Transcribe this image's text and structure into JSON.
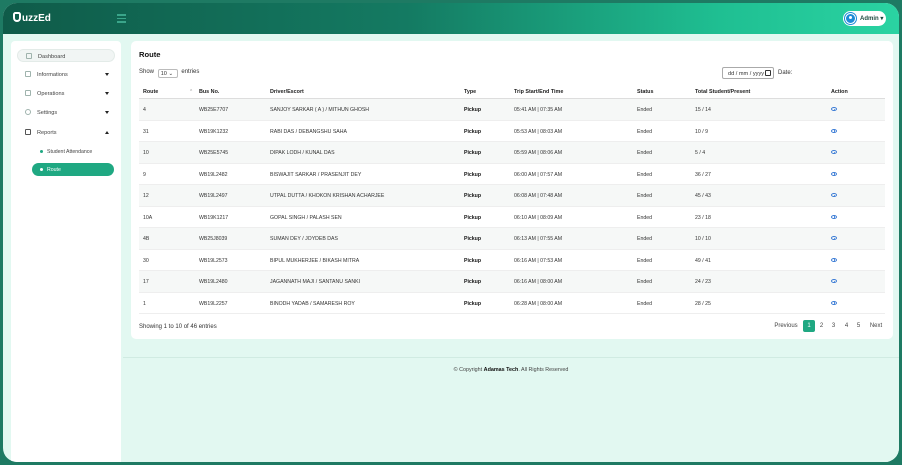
{
  "header": {
    "logo": "uzzEd",
    "admin_label": "Admin"
  },
  "sidebar": {
    "items": [
      {
        "label": "Dashboard",
        "icon": "dashboard-icon"
      },
      {
        "label": "Informations",
        "icon": "info-icon"
      },
      {
        "label": "Operations",
        "icon": "operations-icon"
      },
      {
        "label": "Settings",
        "icon": "gear-icon"
      },
      {
        "label": "Reports",
        "icon": "report-icon"
      }
    ],
    "sub_items": [
      {
        "label": "Student Attendance"
      },
      {
        "label": "Route"
      }
    ]
  },
  "main": {
    "title": "Route",
    "show_label": "Show",
    "show_value": "10",
    "entries_label": "entries",
    "date_placeholder": "dd / mm / yyyy",
    "date_label": "Date:",
    "columns": [
      "Route",
      "Bus No.",
      "Driver/Escort",
      "Type",
      "Trip Start/End Time",
      "Status",
      "Total Student/Present",
      "Action"
    ],
    "rows": [
      [
        "4",
        "WB25E7707",
        "SANJOY SARKAR ( A ) / MITHUN GHOSH",
        "Pickup",
        "05:41 AM | 07:35 AM",
        "Ended",
        "15 / 14"
      ],
      [
        "31",
        "WB19K1232",
        "RABI DAS / DEBANGSHU SAHA",
        "Pickup",
        "05:53 AM | 08:03 AM",
        "Ended",
        "10 / 9"
      ],
      [
        "10",
        "WB25E5745",
        "DIPAK LODH / KUNAL DAS",
        "Pickup",
        "05:59 AM | 08:06 AM",
        "Ended",
        "5 / 4"
      ],
      [
        "9",
        "WB19L2482",
        "BISWAJIT SARKAR / PRASENJIT DEY",
        "Pickup",
        "06:00 AM | 07:57 AM",
        "Ended",
        "36 / 27"
      ],
      [
        "12",
        "WB19L2497",
        "UTPAL DUTTA / KHOKON KRISHAN ACHARJEE",
        "Pickup",
        "06:08 AM | 07:48 AM",
        "Ended",
        "45 / 43"
      ],
      [
        "10A",
        "WB19K1217",
        "GOPAL SINGH / PALASH SEN",
        "Pickup",
        "06:10 AM | 08:09 AM",
        "Ended",
        "23 / 18"
      ],
      [
        "4B",
        "WB25J8039",
        "SUMAN DEY / JOYDEB DAS",
        "Pickup",
        "06:13 AM | 07:55 AM",
        "Ended",
        "10 / 10"
      ],
      [
        "30",
        "WB19L2573",
        "BIPUL MUKHERJEE / BIKASH MITRA",
        "Pickup",
        "06:16 AM | 07:53 AM",
        "Ended",
        "49 / 41"
      ],
      [
        "17",
        "WB19L2480",
        "JAGANNATH MAJI / SANTANU SANKI",
        "Pickup",
        "06:16 AM | 08:00 AM",
        "Ended",
        "24 / 23"
      ],
      [
        "1",
        "WB19L2257",
        "BINODH YADAB / SAMARESH ROY",
        "Pickup",
        "06:28 AM | 08:00 AM",
        "Ended",
        "28 / 25"
      ]
    ],
    "showing": "Showing 1 to 10 of 46 entries",
    "pagination": {
      "previous": "Previous",
      "pages": [
        "1",
        "2",
        "3",
        "4",
        "5"
      ],
      "active_page": "1",
      "next": "Next"
    }
  },
  "footer": {
    "prefix": "© Copyright",
    "company": "Adamas Tech",
    "suffix": ". All Rights Reserved"
  },
  "colors": {
    "accent": "#1fa882",
    "header_dark": "#0f5b49",
    "background": "#e2f8f1"
  }
}
